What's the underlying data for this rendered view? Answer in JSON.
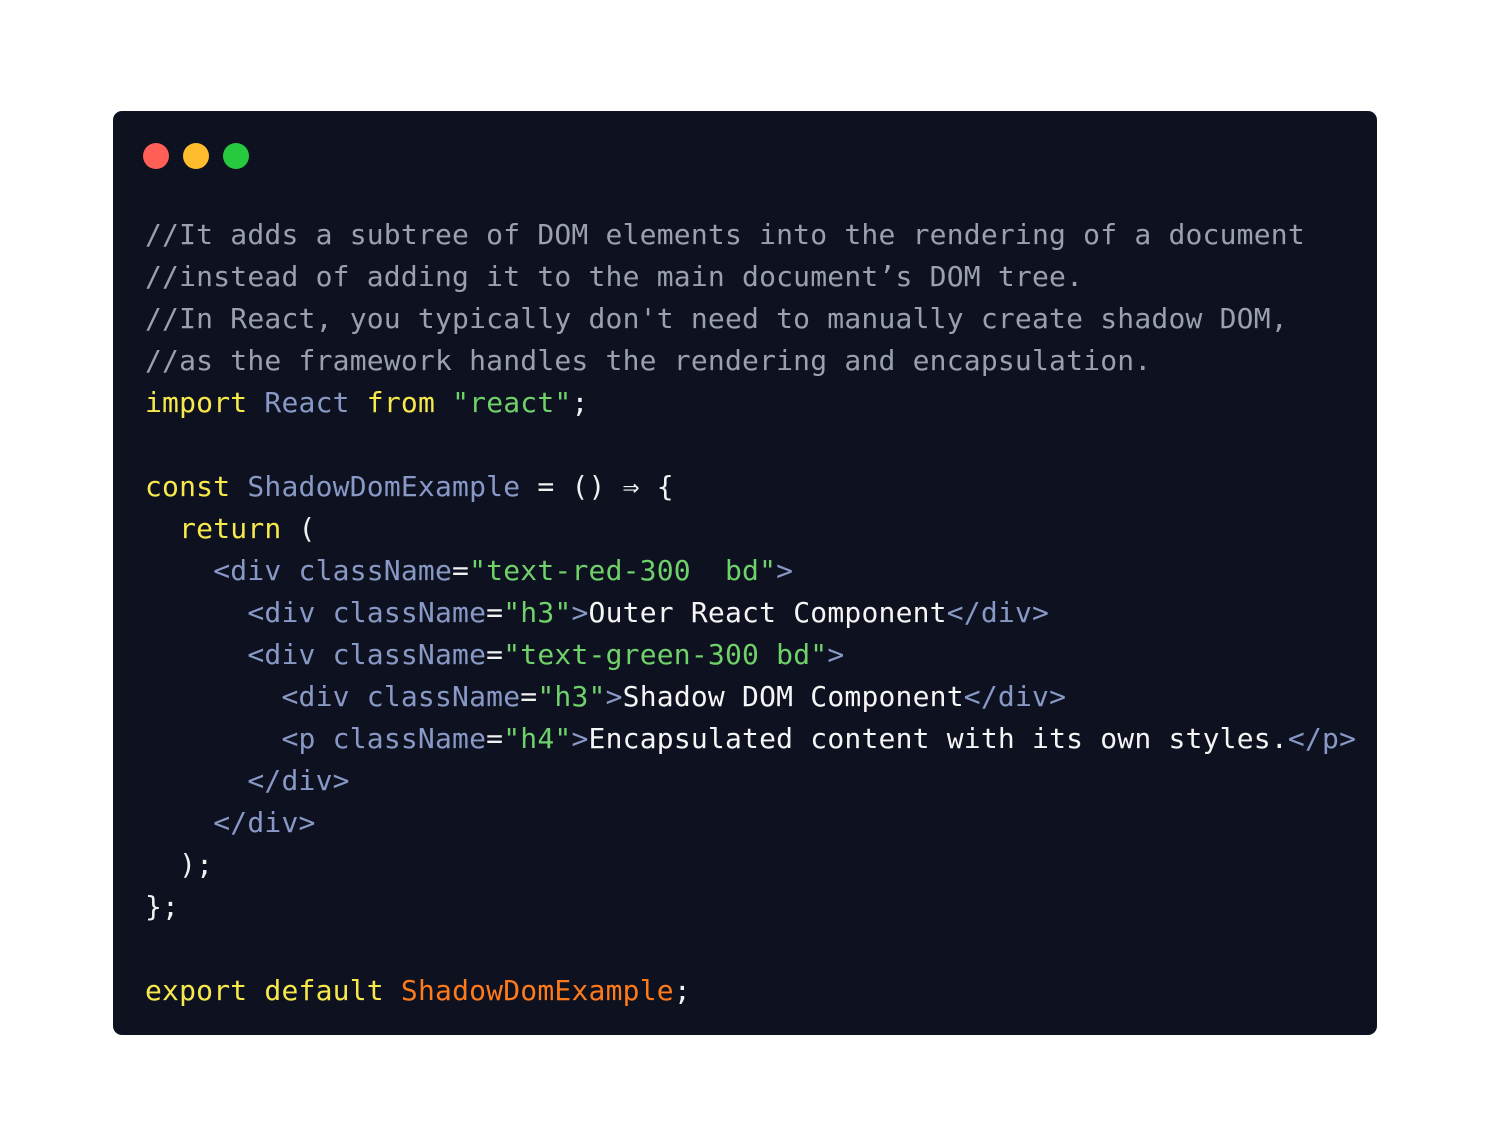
{
  "window": {
    "controls": [
      {
        "name": "close",
        "color": "#ff5f56"
      },
      {
        "name": "minimize",
        "color": "#ffbd2e"
      },
      {
        "name": "maximize",
        "color": "#27c93f"
      }
    ],
    "background": "#0e1120"
  },
  "code": {
    "lines": [
      [
        {
          "t": "comment",
          "v": "//It adds a subtree of DOM elements into the rendering of a document"
        }
      ],
      [
        {
          "t": "comment",
          "v": "//instead of adding it to the main document’s DOM tree."
        }
      ],
      [
        {
          "t": "comment",
          "v": "//In React, you typically don't need to manually create shadow DOM,"
        }
      ],
      [
        {
          "t": "comment",
          "v": "//as the framework handles the rendering and encapsulation."
        }
      ],
      [
        {
          "t": "keyword",
          "v": "import"
        },
        {
          "t": "punct",
          "v": " "
        },
        {
          "t": "ident",
          "v": "React"
        },
        {
          "t": "punct",
          "v": " "
        },
        {
          "t": "keyword",
          "v": "from"
        },
        {
          "t": "punct",
          "v": " "
        },
        {
          "t": "string",
          "v": "\"react\""
        },
        {
          "t": "punct",
          "v": ";"
        }
      ],
      [],
      [
        {
          "t": "keyword",
          "v": "const"
        },
        {
          "t": "punct",
          "v": " "
        },
        {
          "t": "ident",
          "v": "ShadowDomExample"
        },
        {
          "t": "punct",
          "v": " = () ⇒ {"
        }
      ],
      [
        {
          "t": "punct",
          "v": "  "
        },
        {
          "t": "keyword",
          "v": "return"
        },
        {
          "t": "punct",
          "v": " ("
        }
      ],
      [
        {
          "t": "punct",
          "v": "    "
        },
        {
          "t": "tag",
          "v": "<div className"
        },
        {
          "t": "punct",
          "v": "="
        },
        {
          "t": "string",
          "v": "\"text-red-300  bd\""
        },
        {
          "t": "tag",
          "v": ">"
        }
      ],
      [
        {
          "t": "punct",
          "v": "      "
        },
        {
          "t": "tag",
          "v": "<div className"
        },
        {
          "t": "punct",
          "v": "="
        },
        {
          "t": "string",
          "v": "\"h3\""
        },
        {
          "t": "tag",
          "v": ">"
        },
        {
          "t": "text",
          "v": "Outer React Component"
        },
        {
          "t": "tag",
          "v": "</div>"
        }
      ],
      [
        {
          "t": "punct",
          "v": "      "
        },
        {
          "t": "tag",
          "v": "<div className"
        },
        {
          "t": "punct",
          "v": "="
        },
        {
          "t": "string",
          "v": "\"text-green-300 bd\""
        },
        {
          "t": "tag",
          "v": ">"
        }
      ],
      [
        {
          "t": "punct",
          "v": "        "
        },
        {
          "t": "tag",
          "v": "<div className"
        },
        {
          "t": "punct",
          "v": "="
        },
        {
          "t": "string",
          "v": "\"h3\""
        },
        {
          "t": "tag",
          "v": ">"
        },
        {
          "t": "text",
          "v": "Shadow DOM Component"
        },
        {
          "t": "tag",
          "v": "</div>"
        }
      ],
      [
        {
          "t": "punct",
          "v": "        "
        },
        {
          "t": "tag",
          "v": "<p className"
        },
        {
          "t": "punct",
          "v": "="
        },
        {
          "t": "string",
          "v": "\"h4\""
        },
        {
          "t": "tag",
          "v": ">"
        },
        {
          "t": "text",
          "v": "Encapsulated content with its own styles."
        },
        {
          "t": "tag",
          "v": "</p>"
        }
      ],
      [
        {
          "t": "punct",
          "v": "      "
        },
        {
          "t": "tag",
          "v": "</div>"
        }
      ],
      [
        {
          "t": "punct",
          "v": "    "
        },
        {
          "t": "tag",
          "v": "</div>"
        }
      ],
      [
        {
          "t": "punct",
          "v": "  );"
        }
      ],
      [
        {
          "t": "punct",
          "v": "};"
        }
      ],
      [],
      [
        {
          "t": "keyword",
          "v": "export"
        },
        {
          "t": "punct",
          "v": " "
        },
        {
          "t": "keyword",
          "v": "default"
        },
        {
          "t": "punct",
          "v": " "
        },
        {
          "t": "export-ident",
          "v": "ShadowDomExample"
        },
        {
          "t": "punct",
          "v": ";"
        }
      ]
    ]
  }
}
